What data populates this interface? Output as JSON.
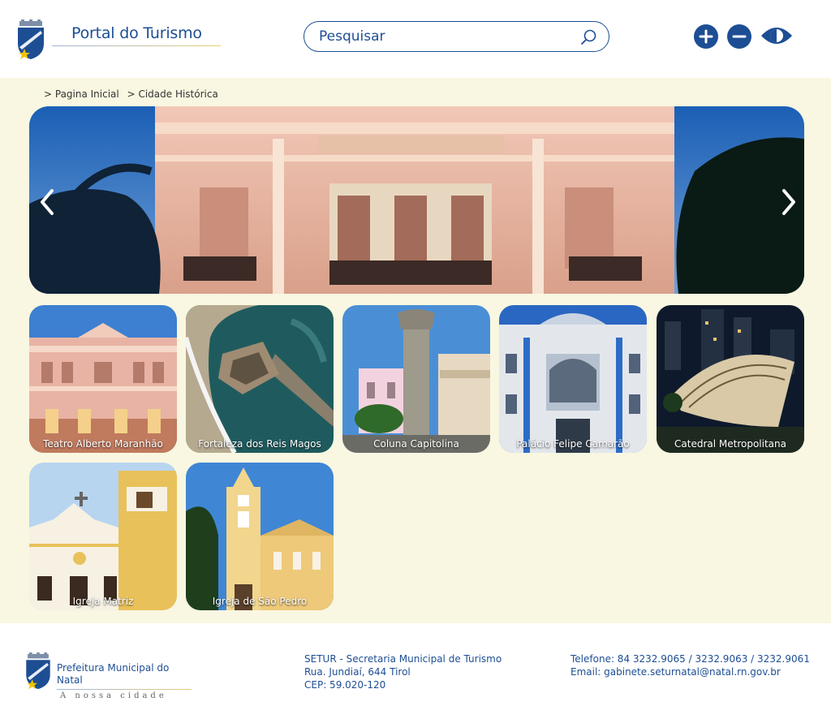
{
  "header": {
    "title": "Portal do Turismo",
    "search_placeholder": "Pesquisar",
    "icons": [
      "search-icon",
      "zoom-in-icon",
      "zoom-out-icon",
      "contrast-icon"
    ]
  },
  "breadcrumb": [
    "> Pagina Inicial",
    "> Cidade Histórica"
  ],
  "carousel": {
    "icons": [
      "chevron-left-icon",
      "chevron-right-icon"
    ]
  },
  "attractions": [
    {
      "label": "Teatro Alberto Maranhão"
    },
    {
      "label": "Fortaleza dos Reis Magos"
    },
    {
      "label": "Coluna Capitolina"
    },
    {
      "label": "Palácio Felipe Camarão"
    },
    {
      "label": "Catedral Metropolitana"
    },
    {
      "label": "Igreja Matriz"
    },
    {
      "label": "Igreja de São Pedro"
    }
  ],
  "footer": {
    "brand_title": "Prefeitura Municipal do Natal",
    "brand_tagline": "A nossa cidade",
    "address": [
      "SETUR - Secretaria Municipal de Turismo",
      "Rua. Jundiaí, 644 Tirol",
      "CEP: 59.020-120"
    ],
    "contact": [
      "Telefone: 84 3232.9065 / 3232.9063 / 3232.9061",
      "Email: gabinete.seturnatal@natal.rn.gov.br"
    ]
  },
  "colors": {
    "brand_blue": "#1d4e94",
    "page_background": "#f9f7e1"
  }
}
